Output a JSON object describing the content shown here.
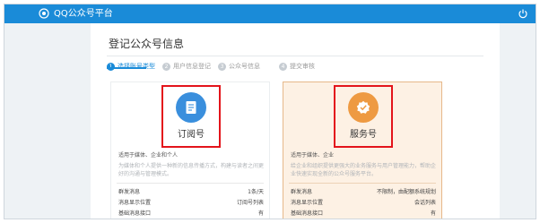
{
  "header": {
    "brand": "QQ公众号平台"
  },
  "page": {
    "title": "登记公众号信息"
  },
  "steps": [
    {
      "num": "1",
      "label": "选择账号类型"
    },
    {
      "num": "2",
      "label": "用户信息登记"
    },
    {
      "num": "3",
      "label": "公众号信息"
    },
    {
      "num": "4",
      "label": "提交审核"
    }
  ],
  "cards": [
    {
      "name": "订阅号",
      "for_label": "适用于媒体、企业和个人",
      "description": "为媒体和个人提供一种新的信息传播方式，构建与读者之间更好的沟通与管理模式。",
      "rows": [
        {
          "key": "群发消息",
          "value": "1条/天"
        },
        {
          "key": "消息显示位置",
          "value": "订阅号列表"
        },
        {
          "key": "基础消息接口",
          "value": "有"
        }
      ]
    },
    {
      "name": "服务号",
      "for_label": "适用于媒体、企业",
      "description": "给企业和组织提供更强大的业务服务与用户管理能力，帮助企业快速实现全新的公众号服务平台。",
      "rows": [
        {
          "key": "群发消息",
          "value": "不限制，由配额系统规划"
        },
        {
          "key": "消息显示位置",
          "value": "会话列表"
        },
        {
          "key": "基础消息接口",
          "value": "有"
        }
      ]
    }
  ],
  "colors": {
    "topbar": "#1a8bd8",
    "accent": "#1a8bd8",
    "subscription_icon": "#3a8fdd",
    "service_icon": "#ee9a42",
    "highlight_border": "#e3141b"
  },
  "icons": {
    "brand": "qq-logo-icon",
    "power": "power-icon",
    "subscription": "document-icon",
    "service": "badge-check-icon"
  }
}
